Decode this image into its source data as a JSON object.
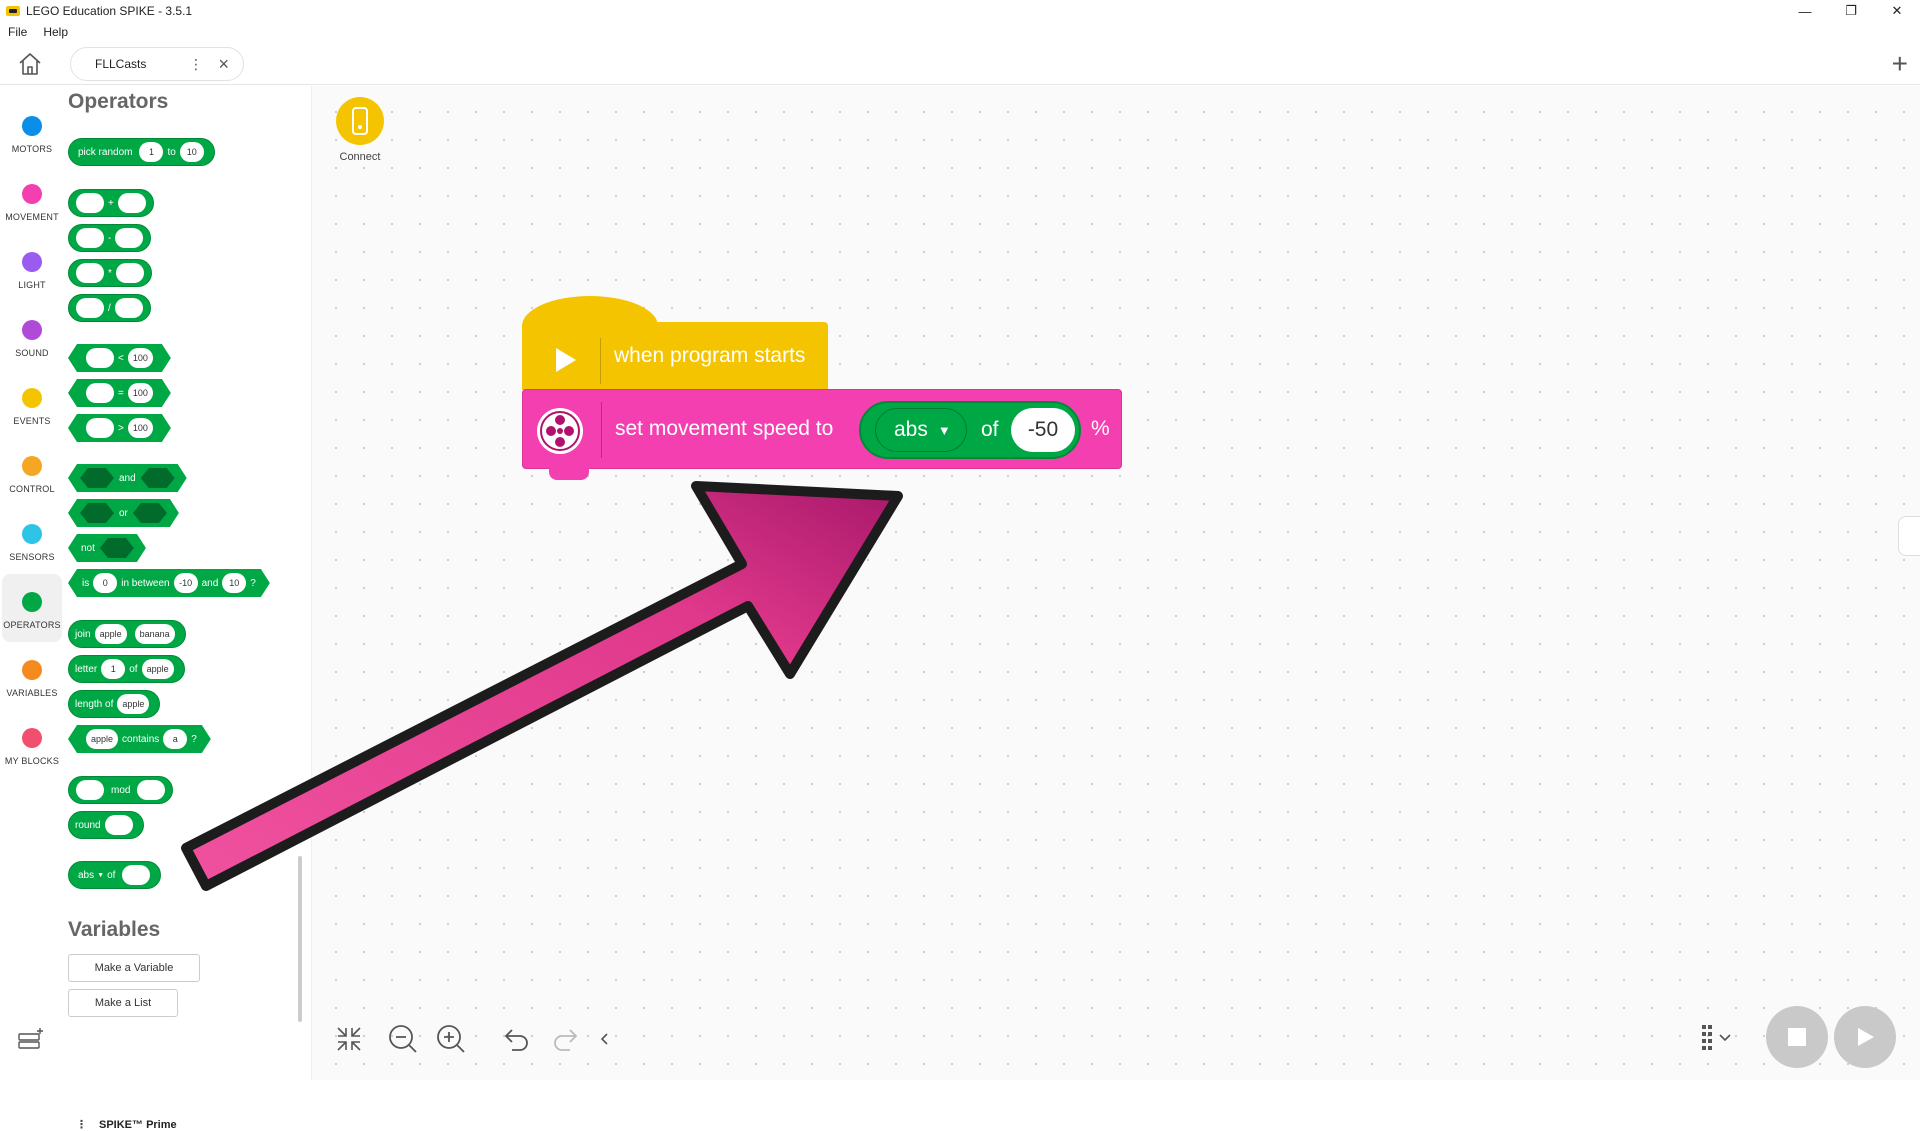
{
  "window": {
    "title": "LEGO Education SPIKE - 3.5.1",
    "controls": [
      "—",
      "❐",
      "✕"
    ]
  },
  "menubar": {
    "items": [
      "File",
      "Help"
    ]
  },
  "tabs": [
    {
      "label": "FLLCasts"
    }
  ],
  "categories": [
    {
      "label": "MOTORS",
      "color": "#0b8ee8"
    },
    {
      "label": "MOVEMENT",
      "color": "#f43fb1"
    },
    {
      "label": "LIGHT",
      "color": "#9a5cf0"
    },
    {
      "label": "SOUND",
      "color": "#b04ad8"
    },
    {
      "label": "EVENTS",
      "color": "#f5c400"
    },
    {
      "label": "CONTROL",
      "color": "#f5a623"
    },
    {
      "label": "SENSORS",
      "color": "#2ec4e8"
    },
    {
      "label": "OPERATORS",
      "color": "#00a845",
      "active": true
    },
    {
      "label": "VARIABLES",
      "color": "#f58a1e"
    },
    {
      "label": "MY BLOCKS",
      "color": "#f0506e"
    }
  ],
  "palette": {
    "operators_heading": "Operators",
    "pick_random": {
      "label": "pick random",
      "from": "1",
      "to_label": "to",
      "to": "10"
    },
    "arith": [
      "+",
      "-",
      "*",
      "/"
    ],
    "compare": [
      {
        "op": "<",
        "value": "100"
      },
      {
        "op": "=",
        "value": "100"
      },
      {
        "op": ">",
        "value": "100"
      }
    ],
    "and_label": "and",
    "or_label": "or",
    "not_label": "not",
    "between": {
      "is": "is",
      "value": "0",
      "in_between": "in between",
      "low": "-10",
      "and": "and",
      "high": "10",
      "q": "?"
    },
    "join": {
      "label": "join",
      "a": "apple",
      "b": "banana"
    },
    "letter": {
      "label": "letter",
      "index": "1",
      "of": "of",
      "word": "apple"
    },
    "length": {
      "label": "length of",
      "word": "apple"
    },
    "contains": {
      "word": "apple",
      "label": "contains",
      "letter": "a",
      "q": "?"
    },
    "mod_label": "mod",
    "round_label": "round",
    "abs": {
      "func": "abs",
      "of": "of"
    },
    "variables_heading": "Variables",
    "make_variable": "Make a Variable",
    "make_list": "Make a List",
    "hub": "SPIKE™ Prime"
  },
  "canvas": {
    "connect_label": "Connect",
    "hat_block": "when program starts",
    "motion_block": {
      "label": "set movement speed to",
      "func": "abs",
      "of": "of",
      "value": "-50",
      "unit": "%"
    }
  },
  "colors": {
    "events": "#f5c400",
    "movement": "#f43fb1",
    "operators": "#00a845",
    "arrow": "#e83e98"
  }
}
